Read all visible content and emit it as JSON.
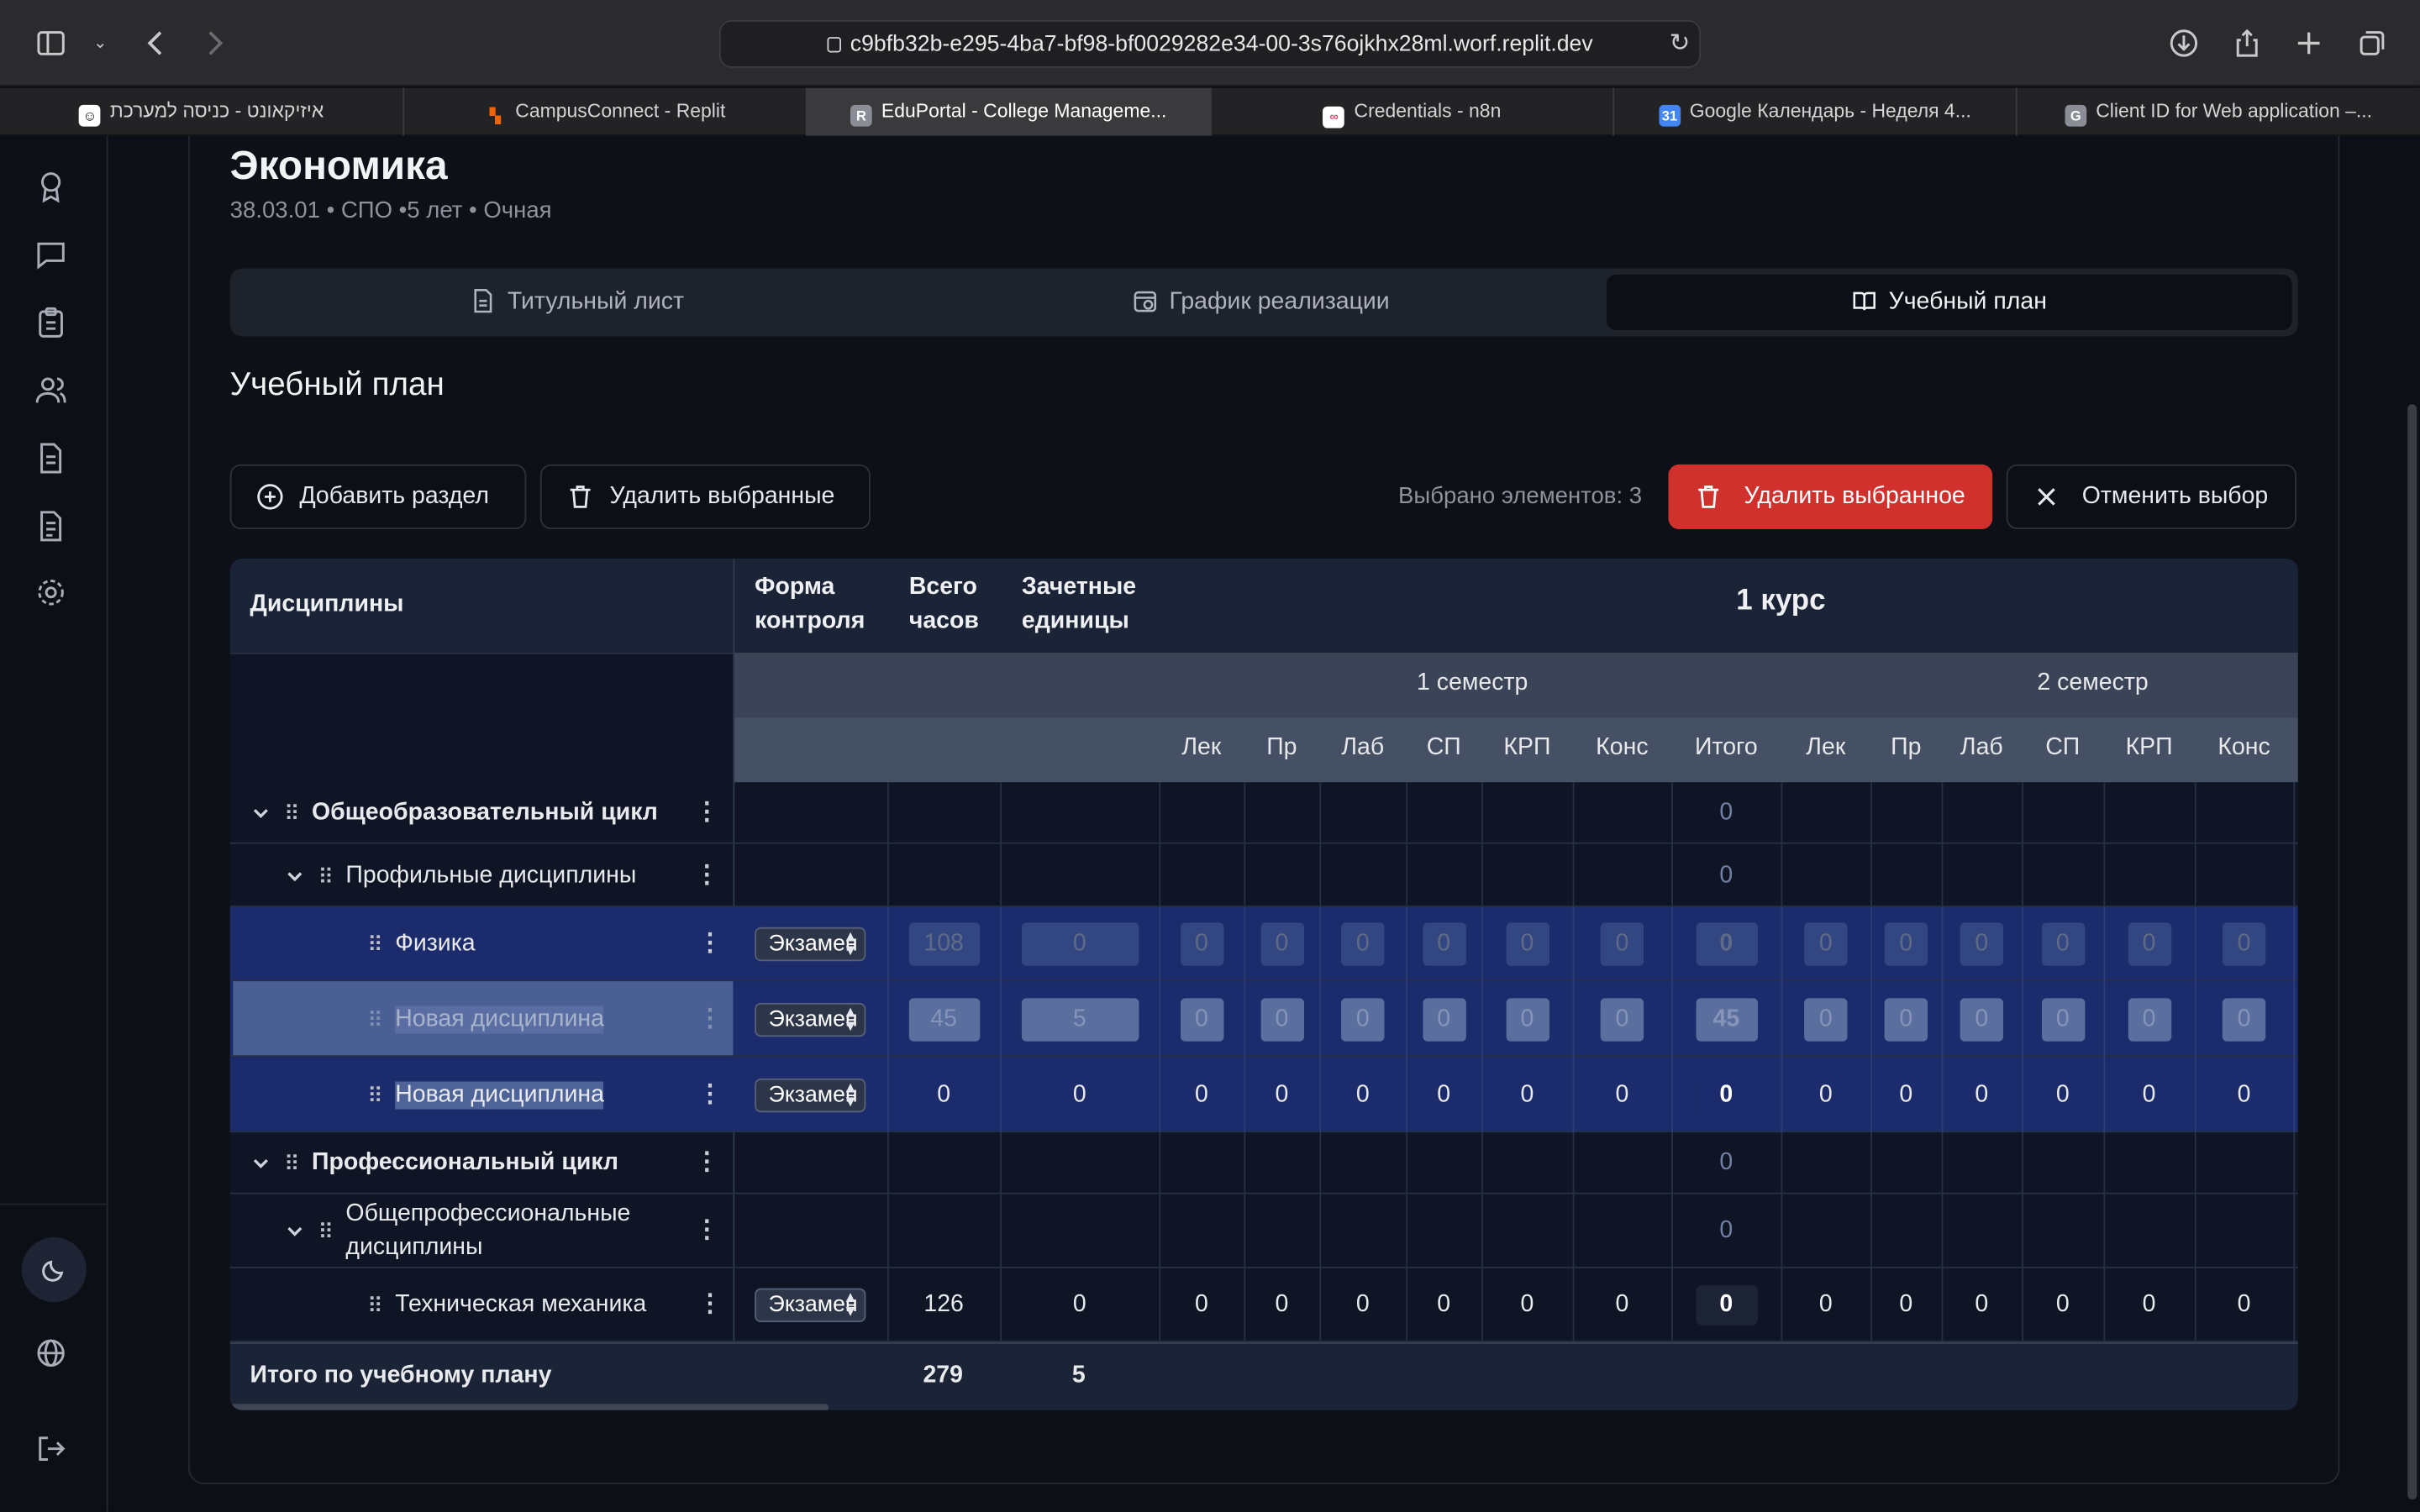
{
  "browser": {
    "url": "c9bfb32b-e295-4ba7-bf98-bf0029282e34-00-3s76ojkhx28ml.worf.replit.dev",
    "tabs": [
      {
        "label": "איזיקאונט - כניסה למערכת",
        "icon": "app-icon",
        "color": "#ffffff"
      },
      {
        "label": "CampusConnect - Replit",
        "icon": "replit-icon",
        "color": "#f26207"
      },
      {
        "label": "EduPortal - College Manageme...",
        "icon": "letter-r-icon",
        "color": "#8a8d96",
        "active": true
      },
      {
        "label": "Credentials - n8n",
        "icon": "n8n-icon",
        "color": "#ea4b71"
      },
      {
        "label": "Google Календарь - Неделя 4...",
        "icon": "google-calendar-icon",
        "color": "#4285f4"
      },
      {
        "label": "Client ID for Web application –...",
        "icon": "letter-g-icon",
        "color": "#8a8d96"
      }
    ]
  },
  "page": {
    "title": "Экономика",
    "subtitle": "38.03.01 • СПО •5 лет • Очная",
    "tabs": [
      "Титульный лист",
      "График реализации",
      "Учебный план"
    ],
    "active_tab": 2,
    "section_title": "Учебный план"
  },
  "toolbar": {
    "add_section": "Добавить раздел",
    "delete_selected": "Удалить выбранные",
    "selected_count": "Выбрано элементов: 3",
    "delete_selected_red": "Удалить выбранное",
    "cancel_selection": "Отменить выбор"
  },
  "table": {
    "col_disciplines": "Дисциплины",
    "col_form_1": "Форма",
    "col_form_2": "контроля",
    "col_hours_1": "Всего",
    "col_hours_2": "часов",
    "col_credits_1": "Зачетные",
    "col_credits_2": "единицы",
    "course": "1 курс",
    "semester1": "1 семестр",
    "semester2": "2 семестр",
    "sem1_cols": [
      "Лек",
      "Пр",
      "Лаб",
      "СП",
      "КРП",
      "Конс",
      "Итого"
    ],
    "sem2_cols": [
      "Лек",
      "Пр",
      "Лаб",
      "СП",
      "КРП",
      "Конс"
    ],
    "rows": [
      {
        "label": "Общеобразовательный цикл",
        "level": 0,
        "type": "group",
        "itogo": "0"
      },
      {
        "label": "Профильные дисциплины",
        "level": 1,
        "type": "group",
        "itogo": "0"
      },
      {
        "label": "Физика",
        "level": 2,
        "type": "item",
        "form": "Экзамен",
        "hours": "108",
        "credits": "0",
        "sem1": [
          "0",
          "0",
          "0",
          "0",
          "0",
          "0"
        ],
        "itogo": "0",
        "sem2": [
          "0",
          "0",
          "0",
          "0",
          "0",
          "0"
        ],
        "state": "selected"
      },
      {
        "label": "Новая дисциплина",
        "level": 2,
        "type": "item",
        "form": "Экзамен",
        "hours": "45",
        "credits": "5",
        "sem1": [
          "0",
          "0",
          "0",
          "0",
          "0",
          "0"
        ],
        "itogo": "45",
        "sem2": [
          "0",
          "0",
          "0",
          "0",
          "0",
          "0"
        ],
        "state": "selected-light"
      },
      {
        "label": "Новая дисциплина",
        "level": 2,
        "type": "item",
        "form": "Экзамен",
        "hours": "0",
        "credits": "0",
        "sem1": [
          "0",
          "0",
          "0",
          "0",
          "0",
          "0"
        ],
        "itogo": "0",
        "sem2": [
          "0",
          "0",
          "0",
          "0",
          "0",
          "0"
        ],
        "state": "selected-active"
      },
      {
        "label": "Профессиональный цикл",
        "level": 0,
        "type": "group",
        "itogo": "0"
      },
      {
        "label": "Общепрофессиональные дисциплины",
        "label_line1": "Общепрофессиональные",
        "label_line2": "дисциплины",
        "level": 1,
        "type": "group",
        "itogo": "0"
      },
      {
        "label": "Техническая механика",
        "level": 2,
        "type": "item",
        "form": "Экзамен",
        "hours": "126",
        "credits": "0",
        "sem1": [
          "0",
          "0",
          "0",
          "0",
          "0",
          "0"
        ],
        "itogo": "0",
        "sem2": [
          "0",
          "0",
          "0",
          "0",
          "0",
          "0"
        ],
        "state": "normal"
      }
    ],
    "total_label": "Итого по учебному плану",
    "total_hours": "279",
    "total_credits": "5"
  }
}
